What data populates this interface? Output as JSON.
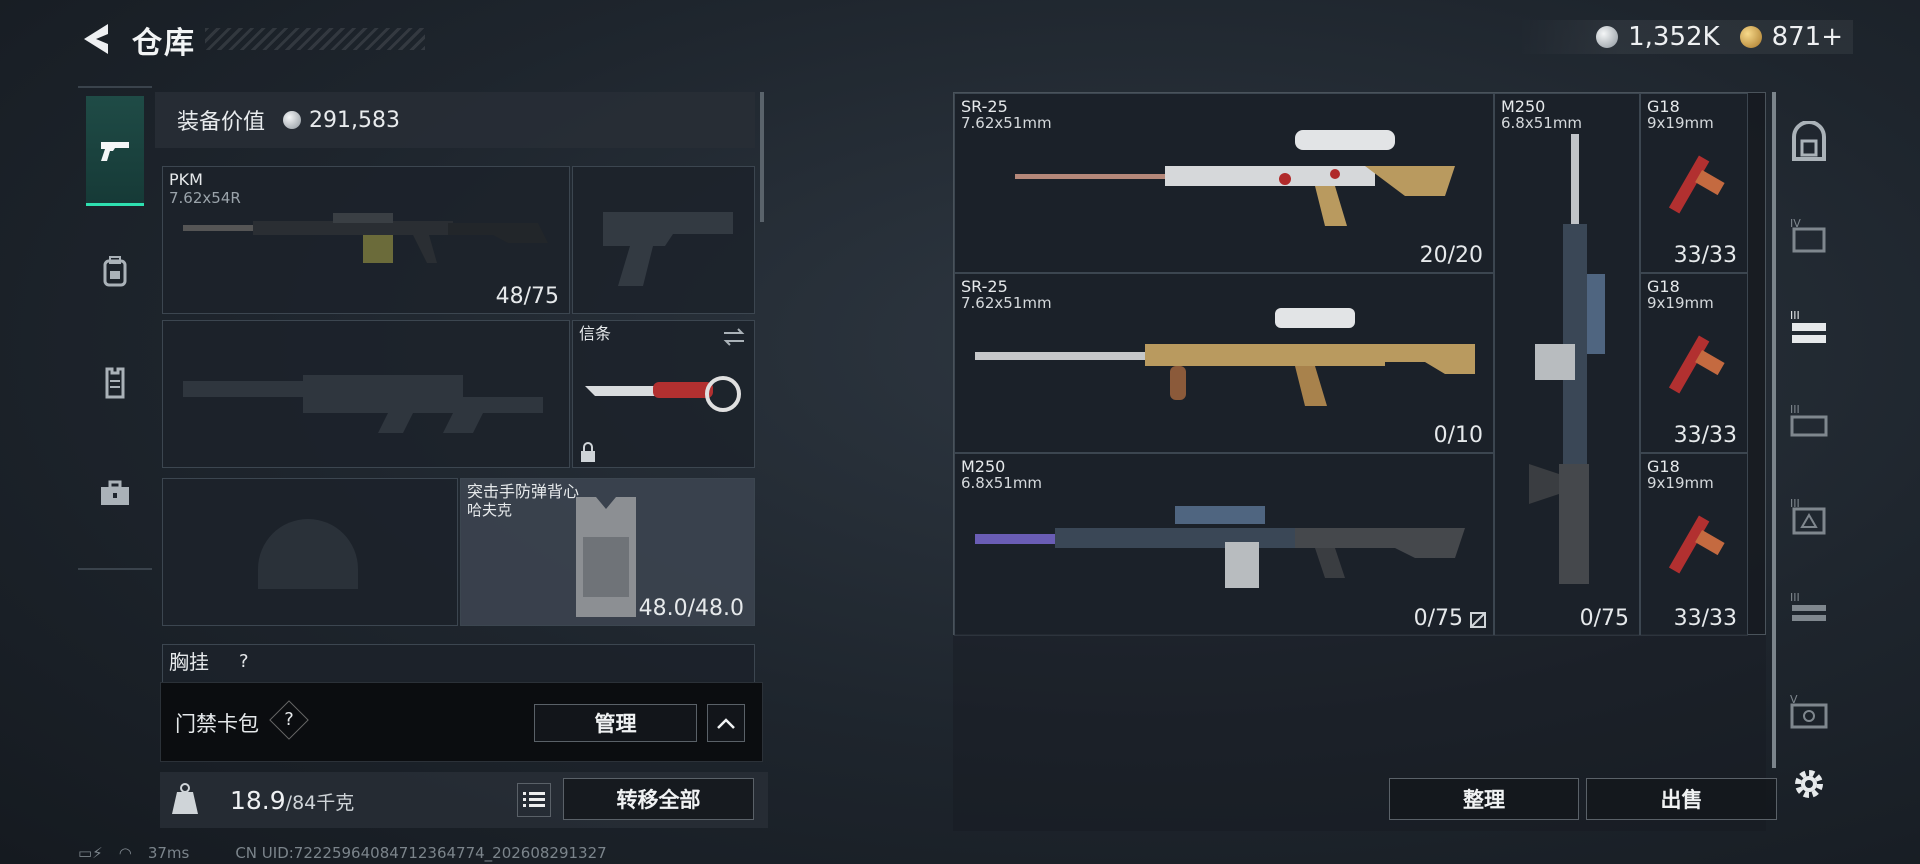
{
  "header": {
    "title": "仓库"
  },
  "currency": [
    {
      "icon": "silver-coin-icon",
      "value": "1,352K"
    },
    {
      "icon": "gold-coin-icon",
      "value": "871+"
    }
  ],
  "left_nav": [
    "pistol-icon",
    "backpack-icon",
    "vest-icon",
    "toolbox-icon"
  ],
  "equipment": {
    "value_label": "装备价值",
    "value": "291,583",
    "primary": {
      "name": "PKM",
      "caliber": "7.62x54R",
      "ammo": "48/75"
    },
    "melee": {
      "name": "信条"
    },
    "armor": {
      "name": "突击手防弹背心",
      "sub": "哈夫克",
      "durability": "48.0/48.0"
    },
    "chest_rig_label": "胸挂",
    "chest_rig_count": "?"
  },
  "keycard": {
    "label": "门禁卡包",
    "help": "?",
    "manage_label": "管理"
  },
  "weight": {
    "current": "18.9",
    "max": "/84千克",
    "transfer_label": "转移全部"
  },
  "status": {
    "ping": "37ms",
    "uid": "CN UID:72225964084712364774_202608291327"
  },
  "storage": [
    {
      "name": "SR-25",
      "caliber": "7.62x51mm",
      "count": "20/20"
    },
    {
      "name": "SR-25",
      "caliber": "7.62x51mm",
      "count": "0/10"
    },
    {
      "name": "M250",
      "caliber": "6.8x51mm",
      "count": "0/75"
    },
    {
      "name": "M250",
      "caliber": "6.8x51mm",
      "count": "0/75"
    },
    {
      "name": "G18",
      "caliber": "9x19mm",
      "count": "33/33"
    },
    {
      "name": "G18",
      "caliber": "9x19mm",
      "count": "33/33"
    },
    {
      "name": "G18",
      "caliber": "9x19mm",
      "count": "33/33"
    }
  ],
  "actions": {
    "sort_label": "整理",
    "sell_label": "出售"
  },
  "right_nav": [
    "safe-box-icon",
    "tier-4-case-icon",
    "tier-3-rack-icon",
    "tier-3-case-icon",
    "tier-3-box-icon",
    "tier-3-shelf-icon",
    "tier-5-case-icon",
    "settings-icon"
  ]
}
